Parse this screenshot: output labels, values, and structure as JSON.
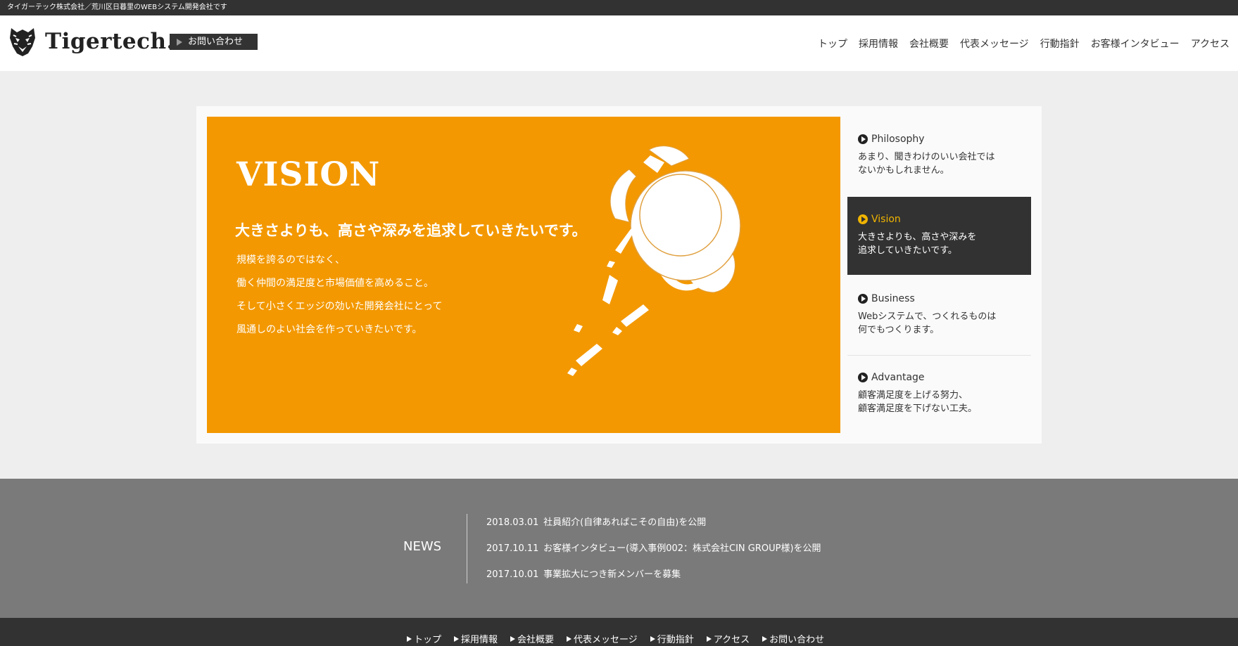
{
  "topbar": {
    "text": "タイガーテック株式会社／荒川区日暮里のWEBシステム開発会社です"
  },
  "header": {
    "logo_text": "Tigertech.",
    "contact_label": "お問い合わせ",
    "nav": [
      "トップ",
      "採用情報",
      "会社概要",
      "代表メッセージ",
      "行動指針",
      "お客様インタビュー",
      "アクセス"
    ]
  },
  "hero": {
    "title": "VISION",
    "subtitle": "大きさよりも、高さや深みを追求していきたいです。",
    "body": [
      "規模を誇るのではなく、",
      "働く仲間の満足度と市場価値を高めること。",
      "そして小さくエッジの効いた開発会社にとって",
      "風通しのよい社会を作っていきたいです。"
    ]
  },
  "side": {
    "items": [
      {
        "title": "Philosophy",
        "line1": "あまり、聞きわけのいい会社では",
        "line2": "ないかもしれません。"
      },
      {
        "title": "Vision",
        "line1": "大きさよりも、高さや深みを",
        "line2": "追求していきたいです。"
      },
      {
        "title": "Business",
        "line1": "Webシステムで、つくれるものは",
        "line2": "何でもつくります。"
      },
      {
        "title": "Advantage",
        "line1": "顧客満足度を上げる努力、",
        "line2": "顧客満足度を下げない工夫。"
      }
    ],
    "active_index": 1
  },
  "news": {
    "label": "NEWS",
    "items": [
      {
        "date": "2018.03.01",
        "text": "社員紹介(自律あればこその自由)を公開"
      },
      {
        "date": "2017.10.11",
        "text": "お客様インタビュー(導入事例002：株式会社CIN GROUP様)を公開"
      },
      {
        "date": "2017.10.01",
        "text": "事業拡大につき新メンバーを募集"
      }
    ]
  },
  "footer": {
    "nav": [
      "トップ",
      "採用情報",
      "会社概要",
      "代表メッセージ",
      "行動指針",
      "アクセス",
      "お問い合わせ"
    ]
  },
  "colors": {
    "accent": "#f39800",
    "dark": "#323232",
    "news_bg": "#7a7a7a",
    "active_text": "#f0b400"
  }
}
